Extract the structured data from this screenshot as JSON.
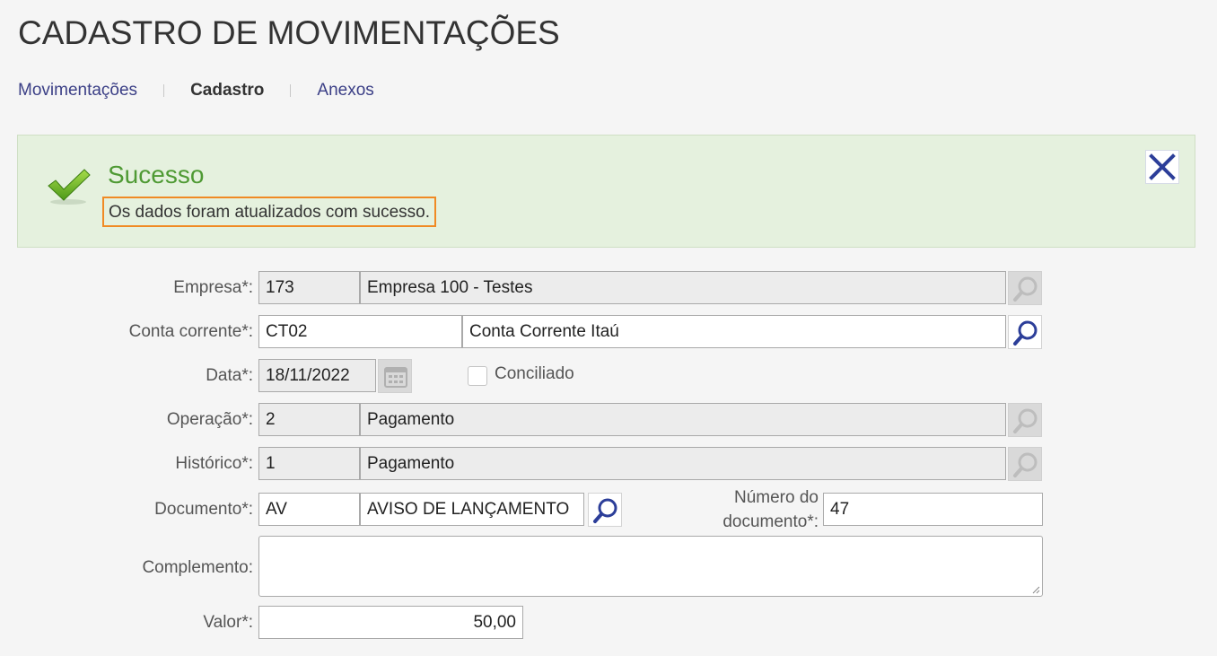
{
  "page": {
    "title": "CADASTRO DE MOVIMENTAÇÕES"
  },
  "tabs": [
    {
      "label": "Movimentações",
      "active": false
    },
    {
      "label": "Cadastro",
      "active": true
    },
    {
      "label": "Anexos",
      "active": false
    }
  ],
  "alert": {
    "title": "Sucesso",
    "message": "Os dados foram atualizados com sucesso.",
    "icon": "checkmark-icon",
    "close_icon": "close-icon",
    "colors": {
      "title": "#4f9a34",
      "background": "#e5f1de",
      "highlight": "#f08a24"
    }
  },
  "form": {
    "empresa": {
      "label": "Empresa*:",
      "code": "173",
      "name": "Empresa 100 - Testes"
    },
    "conta": {
      "label": "Conta corrente*:",
      "code": "CT02",
      "name": "Conta Corrente Itaú"
    },
    "data": {
      "label": "Data*:",
      "value": "18/11/2022"
    },
    "conciliado": {
      "label": "Conciliado",
      "checked": false
    },
    "operacao": {
      "label": "Operação*:",
      "code": "2",
      "name": "Pagamento"
    },
    "historico": {
      "label": "Histórico*:",
      "code": "1",
      "name": "Pagamento"
    },
    "documento": {
      "label": "Documento*:",
      "code": "AV",
      "name": "AVISO DE LANÇAMENTO"
    },
    "numero_documento": {
      "label_line1": "Número do",
      "label_line2": "documento*:",
      "value": "47"
    },
    "complemento": {
      "label": "Complemento:",
      "value": ""
    },
    "valor": {
      "label": "Valor*:",
      "value": "50,00"
    }
  },
  "icons": {
    "search": "search-icon",
    "calendar": "calendar-icon",
    "search_color": "#2c3e99"
  }
}
